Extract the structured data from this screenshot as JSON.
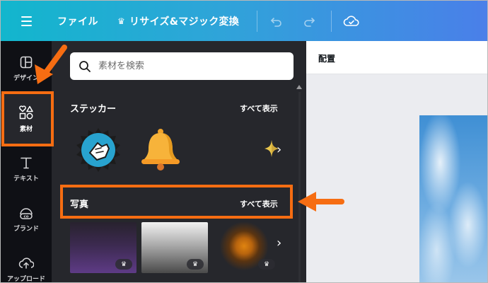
{
  "topbar": {
    "menu_icon": "hamburger-icon",
    "file_label": "ファイル",
    "resize_crown": "♛",
    "resize_label": "リサイズ&マジック変換",
    "undo_icon": "undo-icon",
    "redo_icon": "redo-icon",
    "cloud_icon": "cloud-check-icon"
  },
  "rail": {
    "items": [
      {
        "label": "デザイン",
        "icon": "design-icon"
      },
      {
        "label": "素材",
        "icon": "elements-icon",
        "active": true
      },
      {
        "label": "テキスト",
        "icon": "text-icon"
      },
      {
        "label": "ブランド",
        "icon": "brand-icon"
      },
      {
        "label": "アップロード",
        "icon": "upload-icon"
      }
    ]
  },
  "panel": {
    "search_placeholder": "素材を検索",
    "sticker_title": "ステッカー",
    "sticker_see_all": "すべて表示",
    "photo_title": "写真",
    "photo_see_all": "すべて表示",
    "crown_badge": "♛"
  },
  "editor": {
    "header_label": "配置"
  },
  "colors": {
    "accent_orange": "#f66d12",
    "topbar_start": "#12b6cd",
    "topbar_end": "#4a7fe9",
    "panel_bg": "#26272c",
    "rail_bg": "#0f1015"
  }
}
